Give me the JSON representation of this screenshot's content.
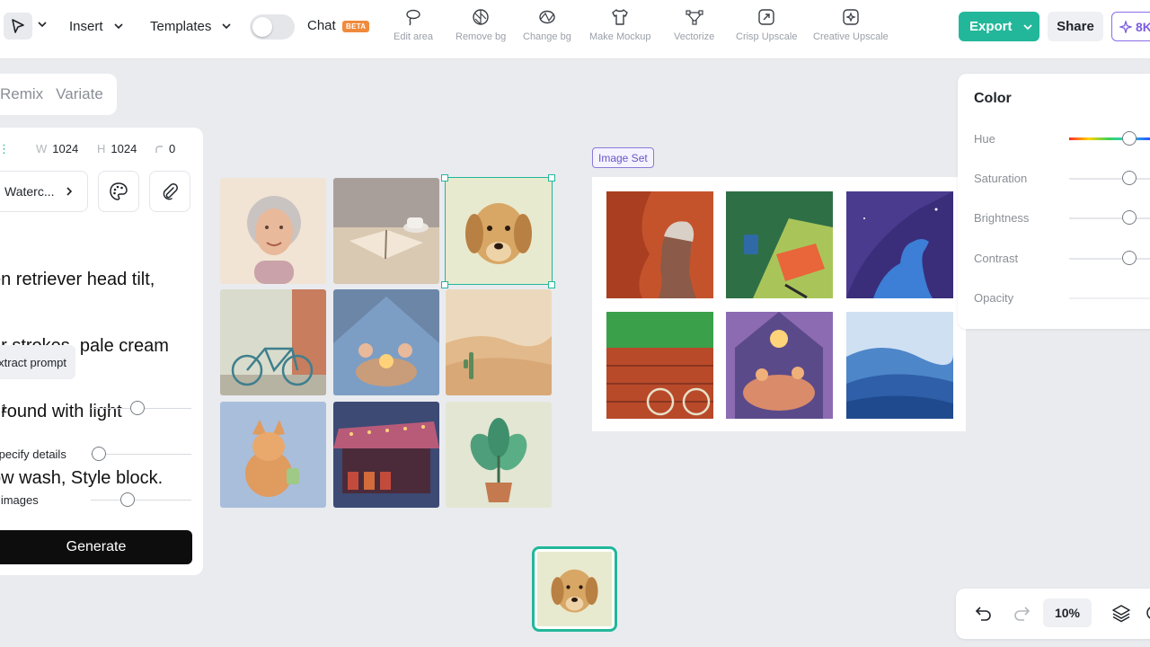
{
  "toolbar": {
    "insert_label": "Insert",
    "templates_label": "Templates",
    "chat_label": "Chat",
    "beta_badge": "BETA",
    "tools": [
      {
        "label": "Edit area",
        "icon": "lasso-icon"
      },
      {
        "label": "Remove bg",
        "icon": "remove-bg-icon"
      },
      {
        "label": "Change bg",
        "icon": "change-bg-icon"
      },
      {
        "label": "Make Mockup",
        "icon": "tshirt-icon"
      },
      {
        "label": "Vectorize",
        "icon": "vector-nodes-icon"
      },
      {
        "label": "Crisp Upscale",
        "icon": "upscale-icon"
      },
      {
        "label": "Creative Upscale",
        "icon": "creative-upscale-icon"
      }
    ],
    "export_label": "Export",
    "share_label": "Share",
    "credits_label": "8K"
  },
  "left_panel": {
    "tabs": [
      "Remix",
      "Variate"
    ],
    "width_key": "W",
    "width_value": "1024",
    "height_key": "H",
    "height_value": "1024",
    "radius_value": "0",
    "style_label": "Waterc...",
    "prompt_lines": [
      "en retriever head tilt,",
      "ur strokes, pale cream",
      "ground with light",
      "ow wash, Style block."
    ],
    "extract_label": "xtract prompt",
    "ratio_label": "1:1",
    "details_label": "Specify details",
    "images_label": "2 images",
    "generate_label": "Generate"
  },
  "canvas": {
    "grid_images": [
      "watercolor-elderly-woman-portrait",
      "watercolor-book-and-tea",
      "watercolor-golden-retriever",
      "watercolor-bicycle-by-wall",
      "watercolor-kids-in-blanket-fort",
      "watercolor-desert-dunes-cactus",
      "watercolor-fox-with-lantern",
      "watercolor-night-market-stall",
      "watercolor-potted-plant"
    ],
    "image_set_label": "Image Set",
    "image_set": [
      "flat-elderly-woman-profile",
      "flat-book-and-mug",
      "flat-blue-dog-night",
      "flat-bicycle-brick-wall",
      "flat-kids-in-fort",
      "flat-blue-dunes"
    ]
  },
  "color_panel": {
    "title": "Color",
    "rows": [
      {
        "label": "Hue",
        "level": 0.6
      },
      {
        "label": "Saturation",
        "level": 0.6
      },
      {
        "label": "Brightness",
        "level": 0.6
      },
      {
        "label": "Contrast",
        "level": 0.6
      },
      {
        "label": "Opacity",
        "level": 1.0
      }
    ]
  },
  "bottom_bar": {
    "zoom_label": "10%"
  },
  "colors": {
    "accent": "#22b79a",
    "purple": "#7b5de0",
    "beta": "#f08a3c"
  }
}
